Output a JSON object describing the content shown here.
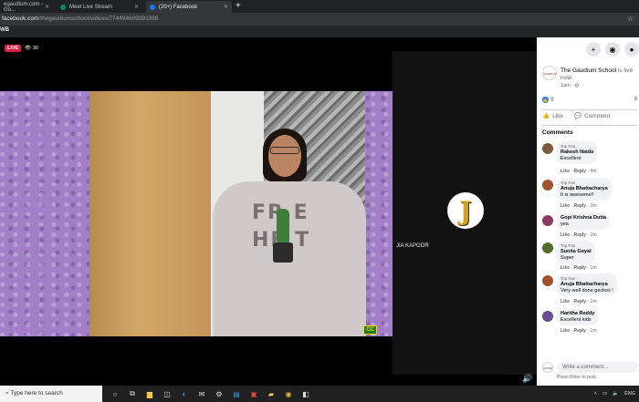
{
  "browser": {
    "tabs": [
      {
        "label": "egaudium.com - Go...",
        "active": false
      },
      {
        "label": "Meet Live Stream",
        "active": false
      },
      {
        "label": "(20+) Facebook",
        "active": true
      }
    ],
    "url_host": "facebook.com",
    "url_path": "/thegaudiumschool/videos/774494609391886"
  },
  "fb_bar": {
    "label": "WB"
  },
  "video": {
    "live_label": "LIVE",
    "viewer_count": "30",
    "hoodie_text": "FR E\nHE T",
    "cc_label": "CC",
    "speaker_initial": "J",
    "speaker_name": "JIA KAPOOR"
  },
  "panel": {
    "page_name": "The Gaudium School",
    "status": " is live now.",
    "time": "1am · ",
    "logo_text": "GAUDIUM",
    "reaction_count": "9",
    "right_count": "8",
    "actions": {
      "like": "Like",
      "comment": "Comment"
    },
    "comments_heading": "Comments",
    "comments": [
      {
        "badge": "Top Fan",
        "name": "Rakesh Naidu",
        "text": "Excellent",
        "time": "4m",
        "color": "#7a5c3a"
      },
      {
        "badge": "Top Fan",
        "name": "Anuja Bhattacharya",
        "text": "It is awesome!!",
        "time": "2m",
        "color": "#a0522d"
      },
      {
        "badge": "",
        "name": "Gopi Krishna Dutta",
        "text": "yea",
        "time": "2m",
        "color": "#8b3a62"
      },
      {
        "badge": "Top Fan",
        "name": "Sunita Goyal",
        "text": "Super",
        "time": "1m",
        "color": "#556b2f"
      },
      {
        "badge": "Top Fan",
        "name": "Anuja Bhattacharya",
        "text": "Very well done geckos !",
        "time": "1m",
        "color": "#a0522d"
      },
      {
        "badge": "",
        "name": "Haritha Reddy",
        "text": "Excellent kids",
        "time": "1m",
        "color": "#6a4c93"
      }
    ],
    "like_label": "Like",
    "reply_label": "Reply",
    "write_placeholder": "Write a comment...",
    "enter_hint": "Press Enter to post."
  },
  "taskbar": {
    "search_placeholder": "Type here to search",
    "lang": "ENG"
  }
}
